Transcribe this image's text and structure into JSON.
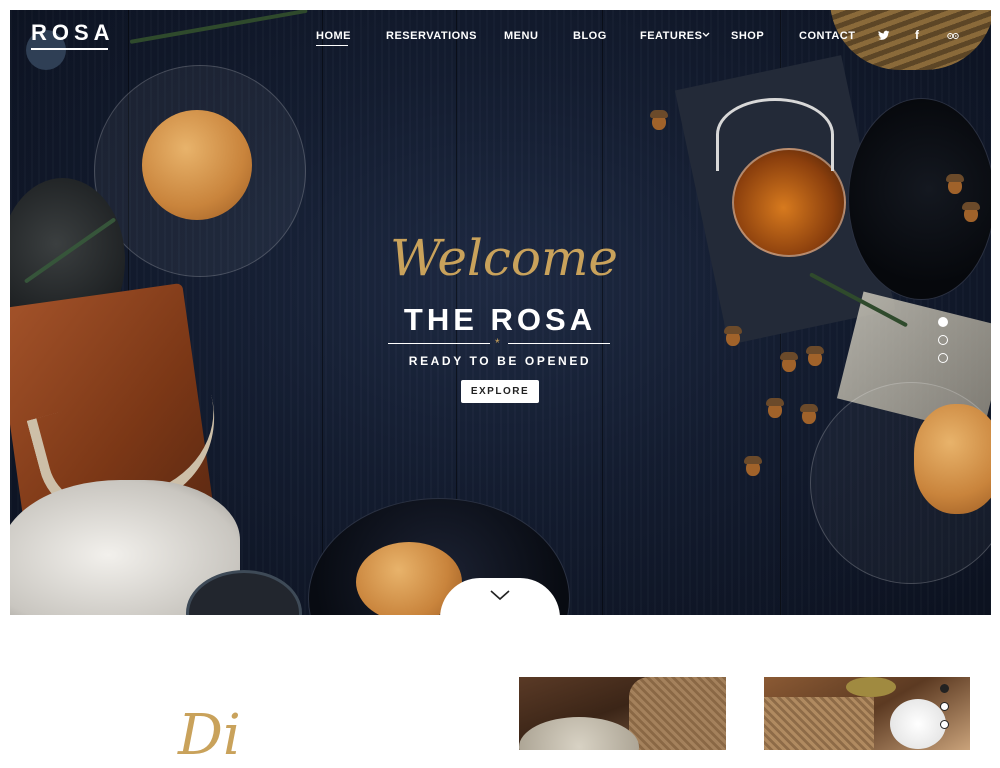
{
  "header": {
    "logo": "ROSA",
    "nav": [
      {
        "label": "HOME",
        "active": true
      },
      {
        "label": "RESERVATIONS"
      },
      {
        "label": "MENU"
      },
      {
        "label": "BLOG"
      },
      {
        "label": "FEATURES",
        "has_dropdown": true
      },
      {
        "label": "SHOP"
      },
      {
        "label": "CONTACT"
      }
    ],
    "social": [
      "twitter-icon",
      "facebook-icon",
      "tripadvisor-icon"
    ],
    "social_glyphs": {
      "twitter": "🐦",
      "facebook": "f",
      "tripadvisor": "◎◎"
    }
  },
  "hero": {
    "script_title": "Welcome",
    "title": "THE ROSA",
    "ornament": "*",
    "subtitle": "READY TO BE OPENED",
    "cta_label": "EXPLORE",
    "slides": 3,
    "active_slide": 1
  },
  "intro": {
    "script_text": "Di",
    "gallery_slides": 3,
    "active_gallery_slide": 1
  },
  "colors": {
    "accent": "#c9a25b",
    "hero_bg": "#141d31",
    "text_light": "#ffffff"
  }
}
